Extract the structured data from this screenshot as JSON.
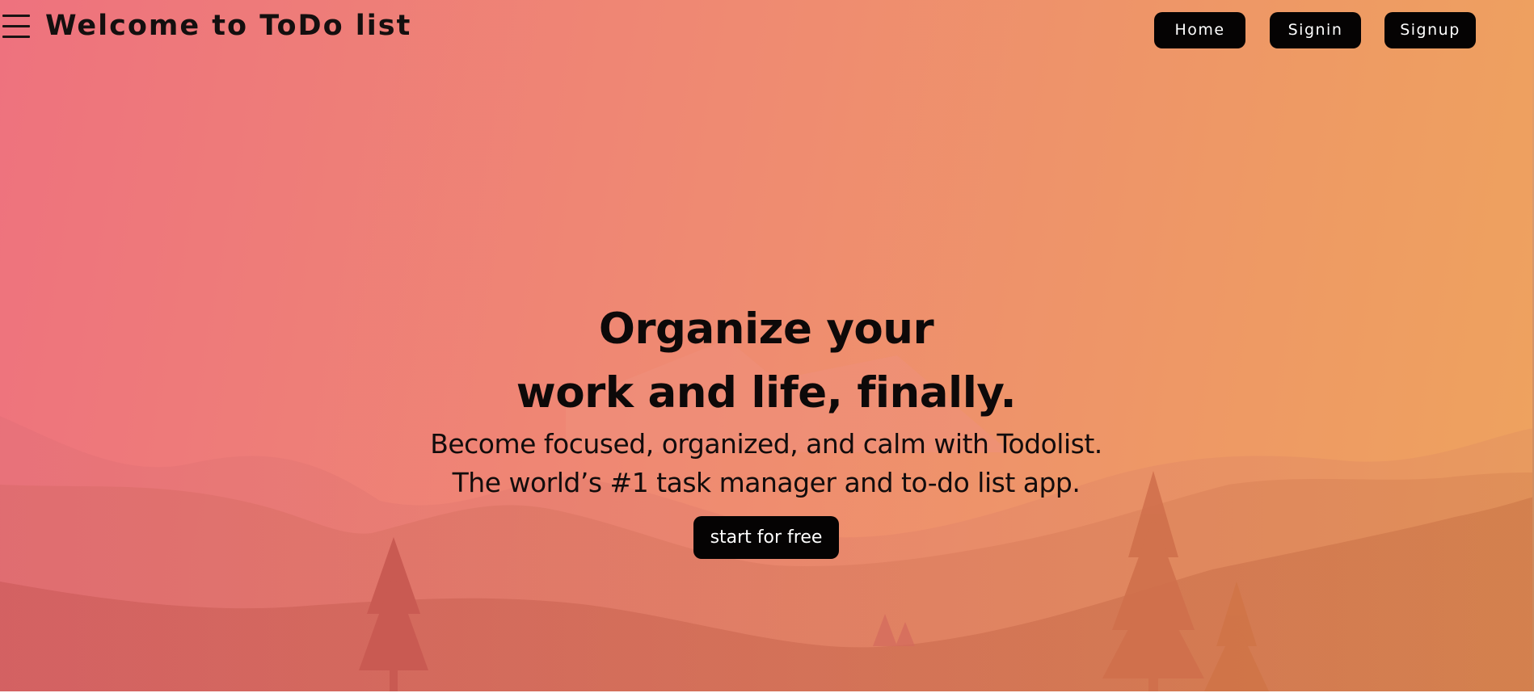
{
  "header": {
    "menu_icon": "hamburger-menu-icon",
    "title": "Welcome to ToDo list",
    "nav": [
      {
        "id": "home",
        "label": "Home"
      },
      {
        "id": "signin",
        "label": "Signin"
      },
      {
        "id": "signup",
        "label": "Signup"
      }
    ]
  },
  "hero": {
    "headline_line1": "Organize your",
    "headline_line2": "work and life, finally.",
    "subtitle_line1": "Become focused, organized, and calm with Todolist.",
    "subtitle_line2": "The world’s #1 task manager and to-do list app.",
    "cta_label": "start for free"
  },
  "colors": {
    "background_start": "#ee727e",
    "background_end": "#eea35e",
    "button_bg": "#050303",
    "button_text": "#ffffff",
    "text": "#0d0909"
  }
}
